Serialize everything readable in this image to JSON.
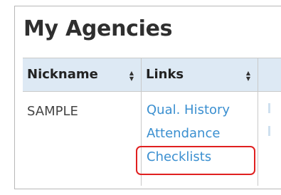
{
  "page": {
    "title": "My Agencies"
  },
  "table": {
    "columns": [
      {
        "label": "Nickname",
        "sortable": true
      },
      {
        "label": "Links",
        "sortable": true
      },
      {
        "label": "",
        "sortable": false
      }
    ],
    "rows": [
      {
        "nickname": "SAMPLE",
        "links": [
          "Qual. History",
          "Attendance",
          "Checklists"
        ]
      }
    ]
  },
  "icons": {
    "sort": "sort-icon"
  },
  "colors": {
    "header_bg": "#dde9f4",
    "link": "#3a8fd0",
    "highlight": "#e02020"
  }
}
